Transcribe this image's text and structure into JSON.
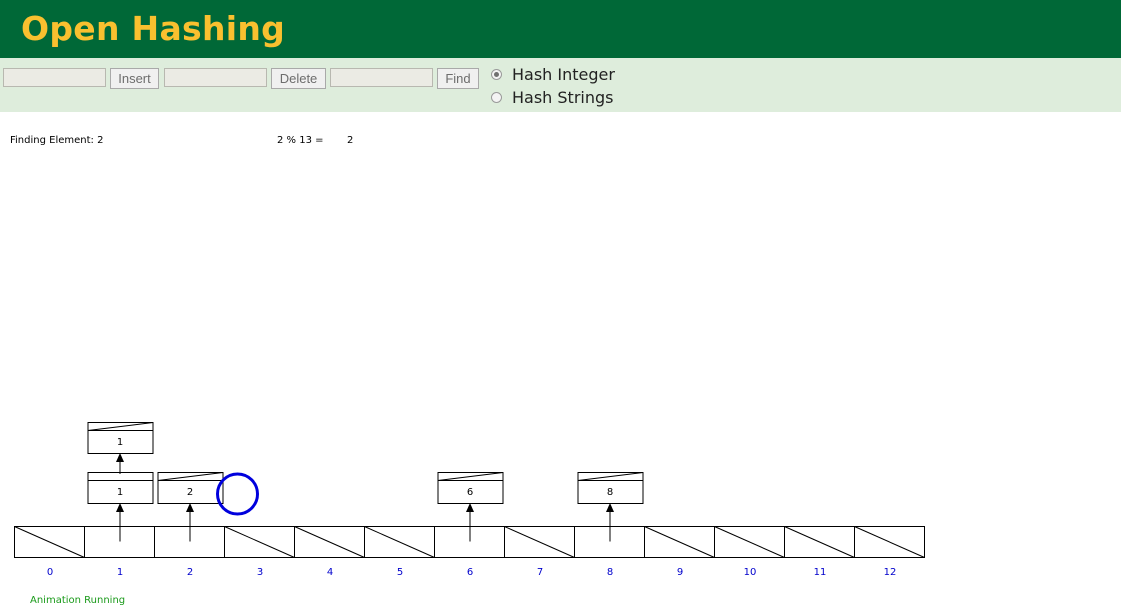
{
  "header": {
    "title": "Open Hashing"
  },
  "toolbar": {
    "insert_value": "",
    "insert_label": "Insert",
    "delete_value": "",
    "delete_label": "Delete",
    "find_value": "",
    "find_label": "Find",
    "radios": [
      {
        "label": "Hash Integer",
        "checked": true
      },
      {
        "label": "Hash Strings",
        "checked": false
      }
    ]
  },
  "canvas": {
    "finding_text": "Finding Element: 2",
    "hash_expr": "2 % 13 =",
    "hash_result": "2",
    "table_size": 13,
    "slot_labels": [
      "0",
      "1",
      "2",
      "3",
      "4",
      "5",
      "6",
      "7",
      "8",
      "9",
      "10",
      "11",
      "12"
    ],
    "chains": [
      {
        "slot": 1,
        "values": [
          "1",
          "1"
        ]
      },
      {
        "slot": 2,
        "values": [
          "2"
        ]
      },
      {
        "slot": 6,
        "values": [
          "6"
        ]
      },
      {
        "slot": 8,
        "values": [
          "8"
        ]
      }
    ],
    "highlight": {
      "slot": 2,
      "color": "#0000dd"
    },
    "index_color": "#0000cc"
  },
  "status": {
    "text": "Animation Running"
  }
}
